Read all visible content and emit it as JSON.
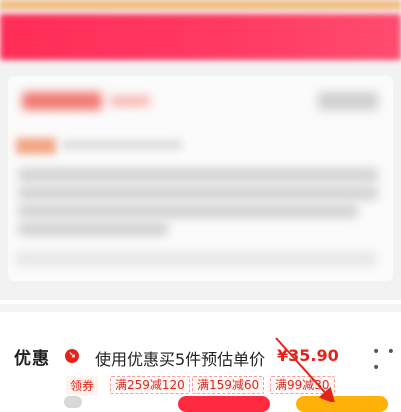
{
  "promo": {
    "title": "优惠",
    "icon": "discount-arrow-icon",
    "description": "使用优惠买5件预估单价",
    "price": "¥35.90",
    "more": "• • •"
  },
  "coupons": {
    "label": "领券",
    "items": [
      "满259减120",
      "满159减60",
      "满99减30"
    ]
  },
  "colors": {
    "accent_red": "#e4241a",
    "banner_red": "#ff3b63",
    "button_red": "#ff2a3f",
    "button_yellow": "#ffb10a"
  }
}
